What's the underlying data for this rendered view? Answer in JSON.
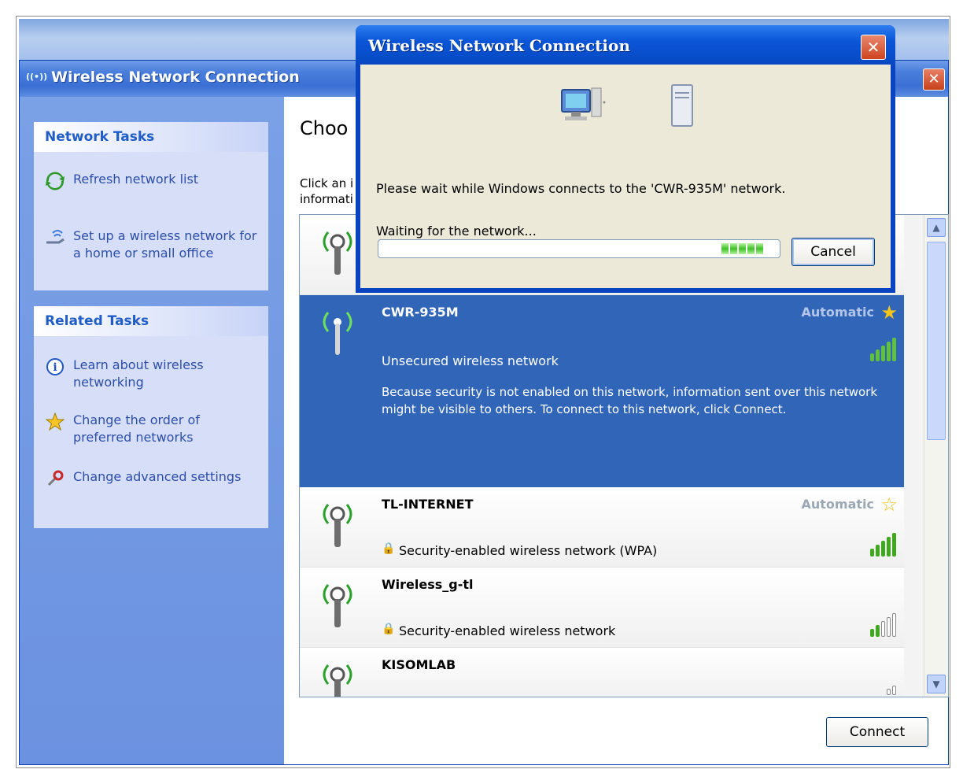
{
  "main_window": {
    "title": "Wireless Network Connection",
    "title_icon": "((•))",
    "close_label": "✕",
    "heading": "Choo",
    "instruction_line1": "Click an i",
    "instruction_line2": "informati"
  },
  "network_tasks": {
    "title": "Network Tasks",
    "items": [
      {
        "label": "Refresh network list",
        "icon": "refresh-icon"
      },
      {
        "label": "Set up a wireless network for a home or small office",
        "icon": "setup-wireless-icon"
      }
    ]
  },
  "related_tasks": {
    "title": "Related Tasks",
    "items": [
      {
        "label": "Learn about wireless networking",
        "icon": "info-icon"
      },
      {
        "label": "Change the order of preferred networks",
        "icon": "star-icon"
      },
      {
        "label": "Change advanced settings",
        "icon": "settings-icon"
      }
    ]
  },
  "networks": [
    {
      "name": "CWR-935M",
      "connection": "Automatic",
      "security": "Unsecured wireless network",
      "description": "Because security is not enabled on this network, information sent over this network might be visible to others. To connect to this network, click Connect.",
      "signal_bars": 5,
      "selected": true
    },
    {
      "name": "TL-INTERNET",
      "connection": "Automatic",
      "security": "Security-enabled wireless network (WPA)",
      "signal_bars": 5,
      "selected": false
    },
    {
      "name": "Wireless_g-tl",
      "connection": "",
      "security": "Security-enabled wireless network",
      "signal_bars": 2,
      "selected": false
    },
    {
      "name": "KISOMLAB",
      "connection": "",
      "security": "",
      "signal_bars": 1,
      "selected": false
    }
  ],
  "connect_button": "Connect",
  "dialog": {
    "title": "Wireless Network Connection",
    "close_label": "✕",
    "message": "Please wait while Windows connects to the 'CWR-935M' network.",
    "status": "Waiting for the network...",
    "cancel_button": "Cancel",
    "progress_blocks": 5
  },
  "colors": {
    "selection": "#3165b8",
    "xp_blue": "#0a56d8",
    "task_text": "#2d4ea8",
    "signal_green": "#3ea91e"
  }
}
